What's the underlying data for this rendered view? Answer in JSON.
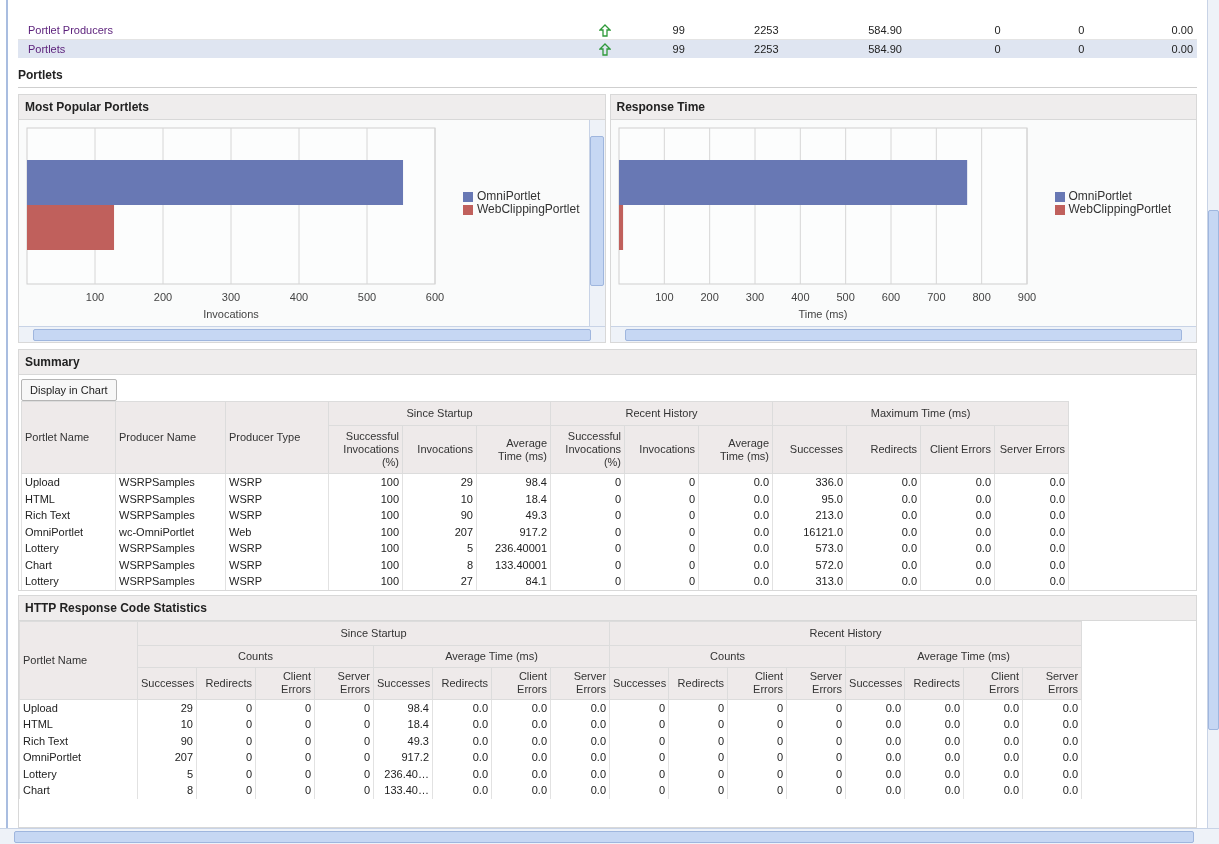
{
  "top_table": {
    "rows": [
      {
        "name": "Portlet Producers",
        "selected": false,
        "cells": [
          "99",
          "2253",
          "584.90",
          "0",
          "0",
          "0.00"
        ]
      },
      {
        "name": "Portlets",
        "selected": true,
        "cells": [
          "99",
          "2253",
          "584.90",
          "0",
          "0",
          "0.00"
        ]
      }
    ]
  },
  "section": {
    "title": "Portlets"
  },
  "charts": [
    {
      "title": "Most Popular Portlets",
      "chart_data": {
        "type": "bar",
        "orientation": "horizontal",
        "grid": true,
        "legend": true,
        "xlabel": "Invocations",
        "series": [
          {
            "name": "OmniPortlet",
            "color": "#6878b4",
            "values": [
              553
            ]
          },
          {
            "name": "WebClippingPortlet",
            "color": "#c0605c",
            "values": [
              128
            ]
          }
        ],
        "xlim": [
          0,
          600
        ],
        "xticks": [
          100,
          200,
          300,
          400,
          500,
          600
        ]
      }
    },
    {
      "title": "Response Time",
      "chart_data": {
        "type": "bar",
        "orientation": "horizontal",
        "grid": true,
        "legend": true,
        "xlabel": "Time (ms)",
        "series": [
          {
            "name": "OmniPortlet",
            "color": "#6878b4",
            "values": [
              768
            ]
          },
          {
            "name": "WebClippingPortlet",
            "color": "#c0605c",
            "values": [
              9
            ]
          }
        ],
        "xlim": [
          0,
          900
        ],
        "xticks": [
          100,
          200,
          300,
          400,
          500,
          600,
          700,
          800,
          900
        ]
      }
    }
  ],
  "summary": {
    "title": "Summary",
    "button": "Display in Chart",
    "leading_columns": [
      "Portlet Name",
      "Producer Name",
      "Producer Type"
    ],
    "groups": [
      {
        "label": "Since Startup",
        "columns": [
          "Successful Invocations (%)",
          "Invocations",
          "Average Time (ms)"
        ]
      },
      {
        "label": "Recent History",
        "columns": [
          "Successful Invocations (%)",
          "Invocations",
          "Average Time (ms)"
        ]
      },
      {
        "label": "Maximum Time (ms)",
        "columns": [
          "Successes",
          "Redirects",
          "Client Errors",
          "Server Errors"
        ]
      }
    ],
    "rows": [
      [
        "Upload",
        "WSRPSamples",
        "WSRP",
        "100",
        "29",
        "98.4",
        "0",
        "0",
        "0.0",
        "336.0",
        "0.0",
        "0.0",
        "0.0"
      ],
      [
        "HTML",
        "WSRPSamples",
        "WSRP",
        "100",
        "10",
        "18.4",
        "0",
        "0",
        "0.0",
        "95.0",
        "0.0",
        "0.0",
        "0.0"
      ],
      [
        "Rich Text",
        "WSRPSamples",
        "WSRP",
        "100",
        "90",
        "49.3",
        "0",
        "0",
        "0.0",
        "213.0",
        "0.0",
        "0.0",
        "0.0"
      ],
      [
        "OmniPortlet",
        "wc-OmniPortlet",
        "Web",
        "100",
        "207",
        "917.2",
        "0",
        "0",
        "0.0",
        "16121.0",
        "0.0",
        "0.0",
        "0.0"
      ],
      [
        "Lottery",
        "WSRPSamples",
        "WSRP",
        "100",
        "5",
        "236.40001",
        "0",
        "0",
        "0.0",
        "573.0",
        "0.0",
        "0.0",
        "0.0"
      ],
      [
        "Chart",
        "WSRPSamples",
        "WSRP",
        "100",
        "8",
        "133.40001",
        "0",
        "0",
        "0.0",
        "572.0",
        "0.0",
        "0.0",
        "0.0"
      ],
      [
        "Lottery",
        "WSRPSamples",
        "WSRP",
        "100",
        "27",
        "84.1",
        "0",
        "0",
        "0.0",
        "313.0",
        "0.0",
        "0.0",
        "0.0"
      ]
    ]
  },
  "http_stats": {
    "title": "HTTP Response Code Statistics",
    "leading_column": "Portlet Name",
    "groups": [
      {
        "label": "Since Startup",
        "subgroups": [
          {
            "label": "Counts",
            "columns": [
              "Successes",
              "Redirects",
              "Client Errors",
              "Server Errors"
            ]
          },
          {
            "label": "Average Time (ms)",
            "columns": [
              "Successes",
              "Redirects",
              "Client Errors",
              "Server Errors"
            ]
          }
        ]
      },
      {
        "label": "Recent History",
        "subgroups": [
          {
            "label": "Counts",
            "columns": [
              "Successes",
              "Redirects",
              "Client Errors",
              "Server Errors"
            ]
          },
          {
            "label": "Average Time (ms)",
            "columns": [
              "Successes",
              "Redirects",
              "Client Errors",
              "Server Errors"
            ]
          }
        ]
      }
    ],
    "rows": [
      [
        "Upload",
        "29",
        "0",
        "0",
        "0",
        "98.4",
        "0.0",
        "0.0",
        "0.0",
        "0",
        "0",
        "0",
        "0",
        "0.0",
        "0.0",
        "0.0",
        "0.0"
      ],
      [
        "HTML",
        "10",
        "0",
        "0",
        "0",
        "18.4",
        "0.0",
        "0.0",
        "0.0",
        "0",
        "0",
        "0",
        "0",
        "0.0",
        "0.0",
        "0.0",
        "0.0"
      ],
      [
        "Rich Text",
        "90",
        "0",
        "0",
        "0",
        "49.3",
        "0.0",
        "0.0",
        "0.0",
        "0",
        "0",
        "0",
        "0",
        "0.0",
        "0.0",
        "0.0",
        "0.0"
      ],
      [
        "OmniPortlet",
        "207",
        "0",
        "0",
        "0",
        "917.2",
        "0.0",
        "0.0",
        "0.0",
        "0",
        "0",
        "0",
        "0",
        "0.0",
        "0.0",
        "0.0",
        "0.0"
      ],
      [
        "Lottery",
        "5",
        "0",
        "0",
        "0",
        "236.40…",
        "0.0",
        "0.0",
        "0.0",
        "0",
        "0",
        "0",
        "0",
        "0.0",
        "0.0",
        "0.0",
        "0.0"
      ],
      [
        "Chart",
        "8",
        "0",
        "0",
        "0",
        "133.40…",
        "0.0",
        "0.0",
        "0.0",
        "0",
        "0",
        "0",
        "0",
        "0.0",
        "0.0",
        "0.0",
        "0.0"
      ]
    ]
  }
}
